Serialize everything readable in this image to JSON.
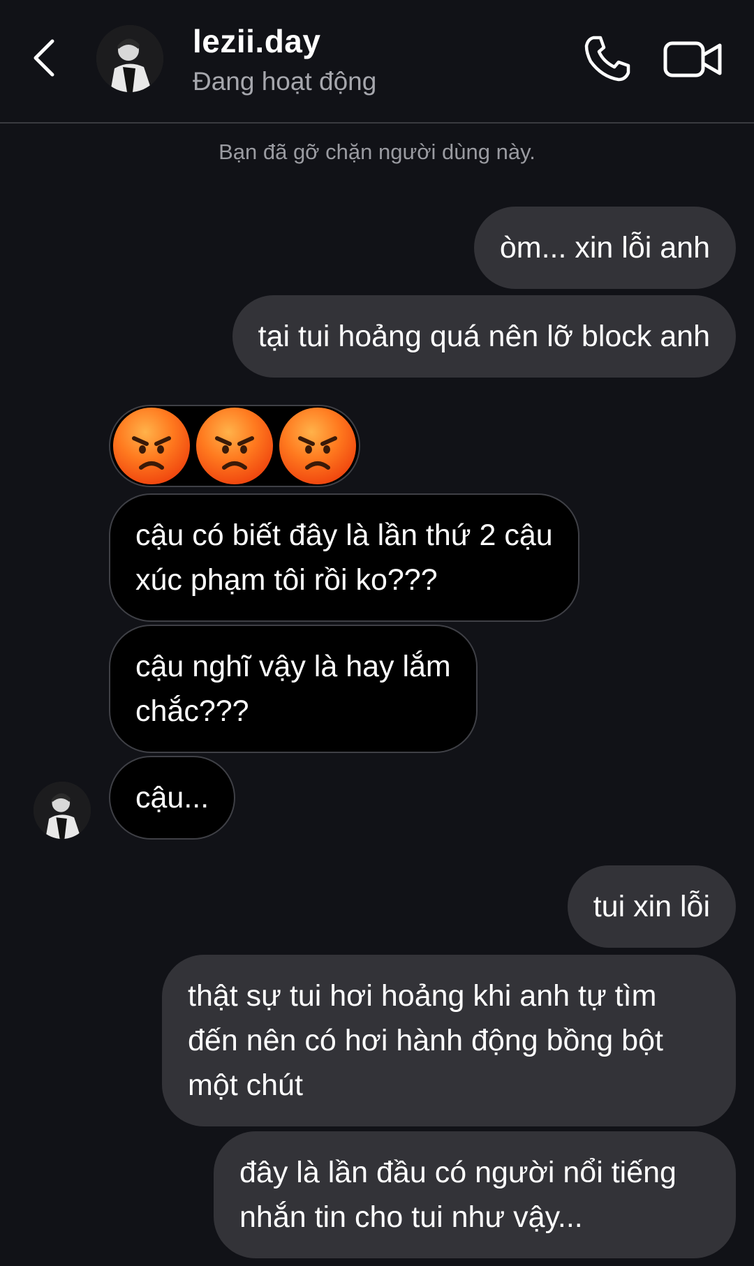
{
  "header": {
    "username": "lezii.day",
    "status": "Đang hoạt động",
    "icons": {
      "back": "chevron-left-icon",
      "call": "phone-icon",
      "video": "video-camera-icon"
    }
  },
  "notice": "Bạn đã gỡ chặn người dùng này.",
  "messages": {
    "m1": {
      "from": "me",
      "lines": [
        "òm... xin lỗi anh"
      ]
    },
    "m2": {
      "from": "me",
      "lines": [
        "tại tui hoảng quá nên lỡ block anh"
      ]
    },
    "m3": {
      "from": "them",
      "emoji": [
        "angry-face",
        "angry-face",
        "angry-face"
      ]
    },
    "m4": {
      "from": "them",
      "lines": [
        "cậu có biết đây là lần thứ 2 cậu",
        "xúc phạm tôi rồi ko???"
      ]
    },
    "m5": {
      "from": "them",
      "lines": [
        "cậu nghĩ vậy là hay lắm",
        "chắc???"
      ]
    },
    "m6": {
      "from": "them",
      "lines": [
        "cậu..."
      ]
    },
    "m7": {
      "from": "me",
      "lines": [
        "tui xin lỗi"
      ]
    },
    "m8": {
      "from": "me",
      "lines": [
        "thật sự tui hơi hoảng khi anh tự tìm",
        "đến nên có hơi hành động bồng bột",
        "một chút"
      ]
    },
    "m9": {
      "from": "me",
      "lines": [
        "đây là lần đầu có người nổi tiếng",
        "nhắn tin cho tui như vậy..."
      ]
    }
  },
  "colors": {
    "background": "#111217",
    "sent_bubble": "#333338",
    "received_bubble": "#000000",
    "received_border": "#3f4046",
    "secondary_text": "#a6a7ad"
  }
}
